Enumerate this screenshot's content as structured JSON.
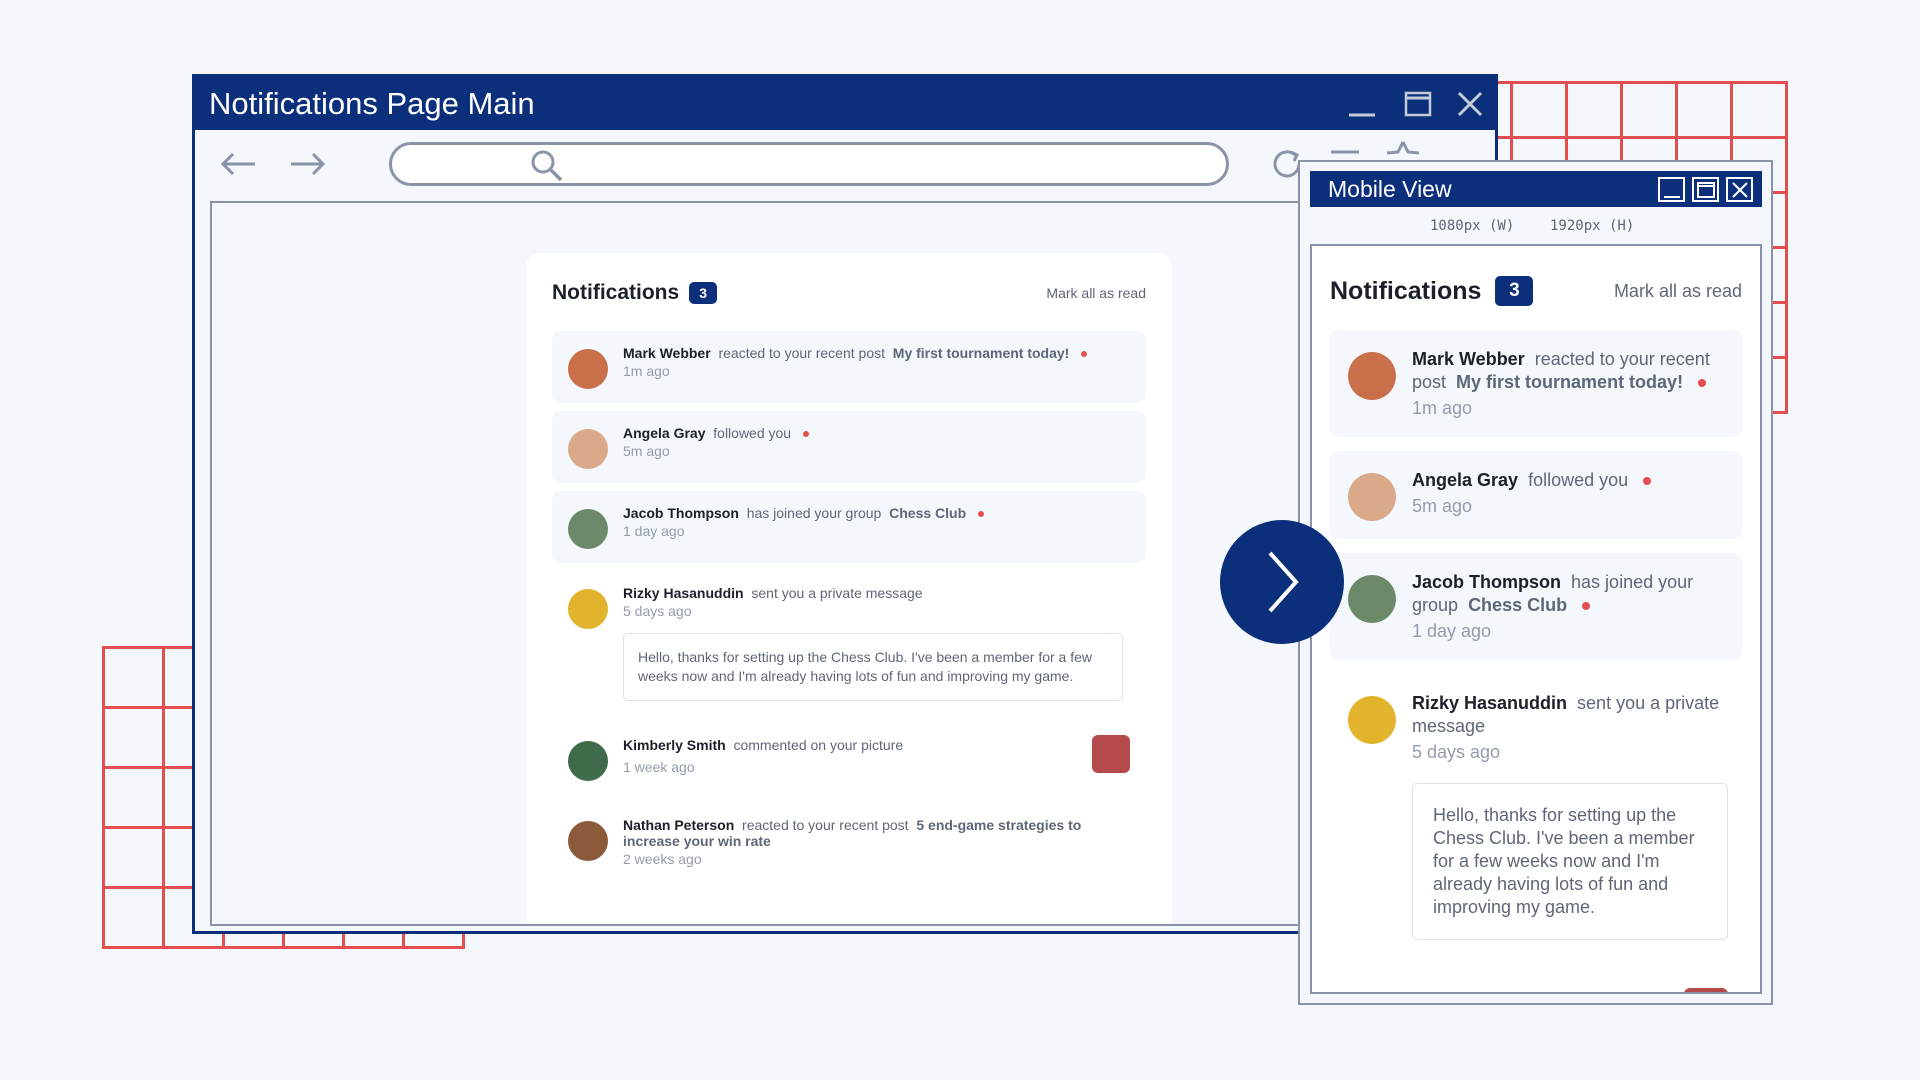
{
  "window": {
    "title": "Notifications Page Main"
  },
  "mobile": {
    "title": "Mobile View",
    "width_label": "1080px (W)",
    "height_label": "1920px (H)"
  },
  "notifications": {
    "title": "Notifications",
    "count": "3",
    "mark_all": "Mark all as read",
    "items": [
      {
        "name": "Mark Webber",
        "action": "reacted to your recent post",
        "object": "My first tournament today!",
        "time": "1m ago",
        "unread": true
      },
      {
        "name": "Angela Gray",
        "action": "followed you",
        "time": "5m ago",
        "unread": true
      },
      {
        "name": "Jacob Thompson",
        "action": "has joined your group",
        "group": "Chess Club",
        "time": "1 day ago",
        "unread": true
      },
      {
        "name": "Rizky Hasanuddin",
        "action": "sent you a private message",
        "time": "5 days ago",
        "message": "Hello, thanks for setting up the Chess Club. I've been a member for a few weeks now and I'm already having lots of fun and improving my game."
      },
      {
        "name": "Kimberly Smith",
        "action": "commented on your picture",
        "time": "1 week ago"
      },
      {
        "name": "Nathan Peterson",
        "action": "reacted to your recent post",
        "object": "5 end-game strategies to increase your win rate",
        "time": "2 weeks ago"
      }
    ],
    "mobile_kimberly_partial": "commented"
  },
  "colors": {
    "brand": "#0b2f7a",
    "accent": "#e54e4e",
    "background": "#f4f7fb"
  },
  "icons": [
    "back-arrow-icon",
    "forward-arrow-icon",
    "search-icon",
    "refresh-icon",
    "menu-icon",
    "star-icon",
    "minimize-icon",
    "maximize-icon",
    "close-icon",
    "chevron-right-icon"
  ]
}
